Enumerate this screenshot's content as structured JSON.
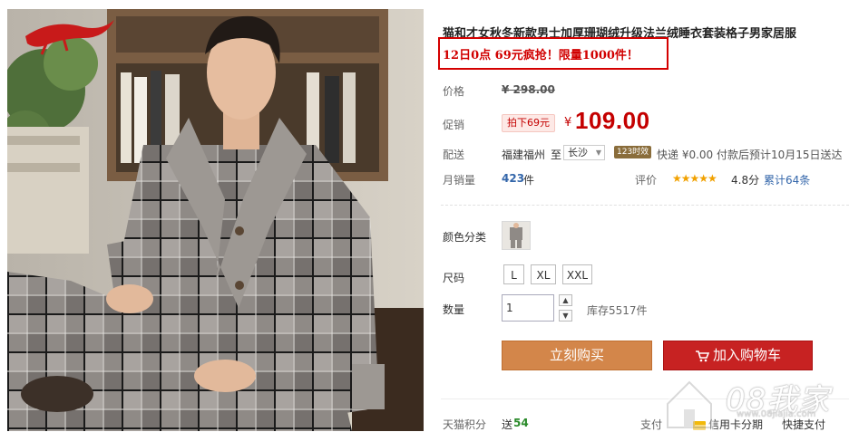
{
  "product": {
    "title": "猫和才女秋冬新款男士加厚珊瑚绒升级法兰绒睡衣套装格子男家居服",
    "promo": "12日0点 69元疯抢！限量1000件！",
    "logo_text": "猫和才女"
  },
  "price": {
    "label": "价格",
    "original": "¥ 298.00"
  },
  "promotion": {
    "label": "促销",
    "badge": "拍下69元",
    "currency": "¥",
    "price": "109.00"
  },
  "delivery": {
    "label": "配送",
    "from": "福建福州",
    "to_word": "至",
    "city": "长沙",
    "tag": "123时效",
    "info": "快递 ¥0.00 付款后预计10月15日送达"
  },
  "sales": {
    "label": "月销量",
    "count": "423",
    "unit": "件",
    "rating_label": "评价",
    "stars": "★★★★★",
    "score": "4.8分",
    "reviews": "累计64条"
  },
  "color": {
    "label": "颜色分类"
  },
  "size": {
    "label": "尺码",
    "options": [
      "L",
      "XL",
      "XXL"
    ]
  },
  "quantity": {
    "label": "数量",
    "value": "1",
    "stock": "库存5517件"
  },
  "buttons": {
    "buy": "立刻购买",
    "cart": "加入购物车"
  },
  "footer": {
    "points_label": "天猫积分",
    "points_prefix": "送",
    "points": "54",
    "pay_label": "支付",
    "installment": "信用卡分期",
    "quick_pay": "快捷支付"
  },
  "watermark": {
    "text": "08我家",
    "sub": "www.08jiajia.com"
  },
  "colors": {
    "accent_red": "#c40000",
    "buy_orange": "#d3864a",
    "cart_red": "#c72222",
    "link_blue": "#3366aa"
  }
}
